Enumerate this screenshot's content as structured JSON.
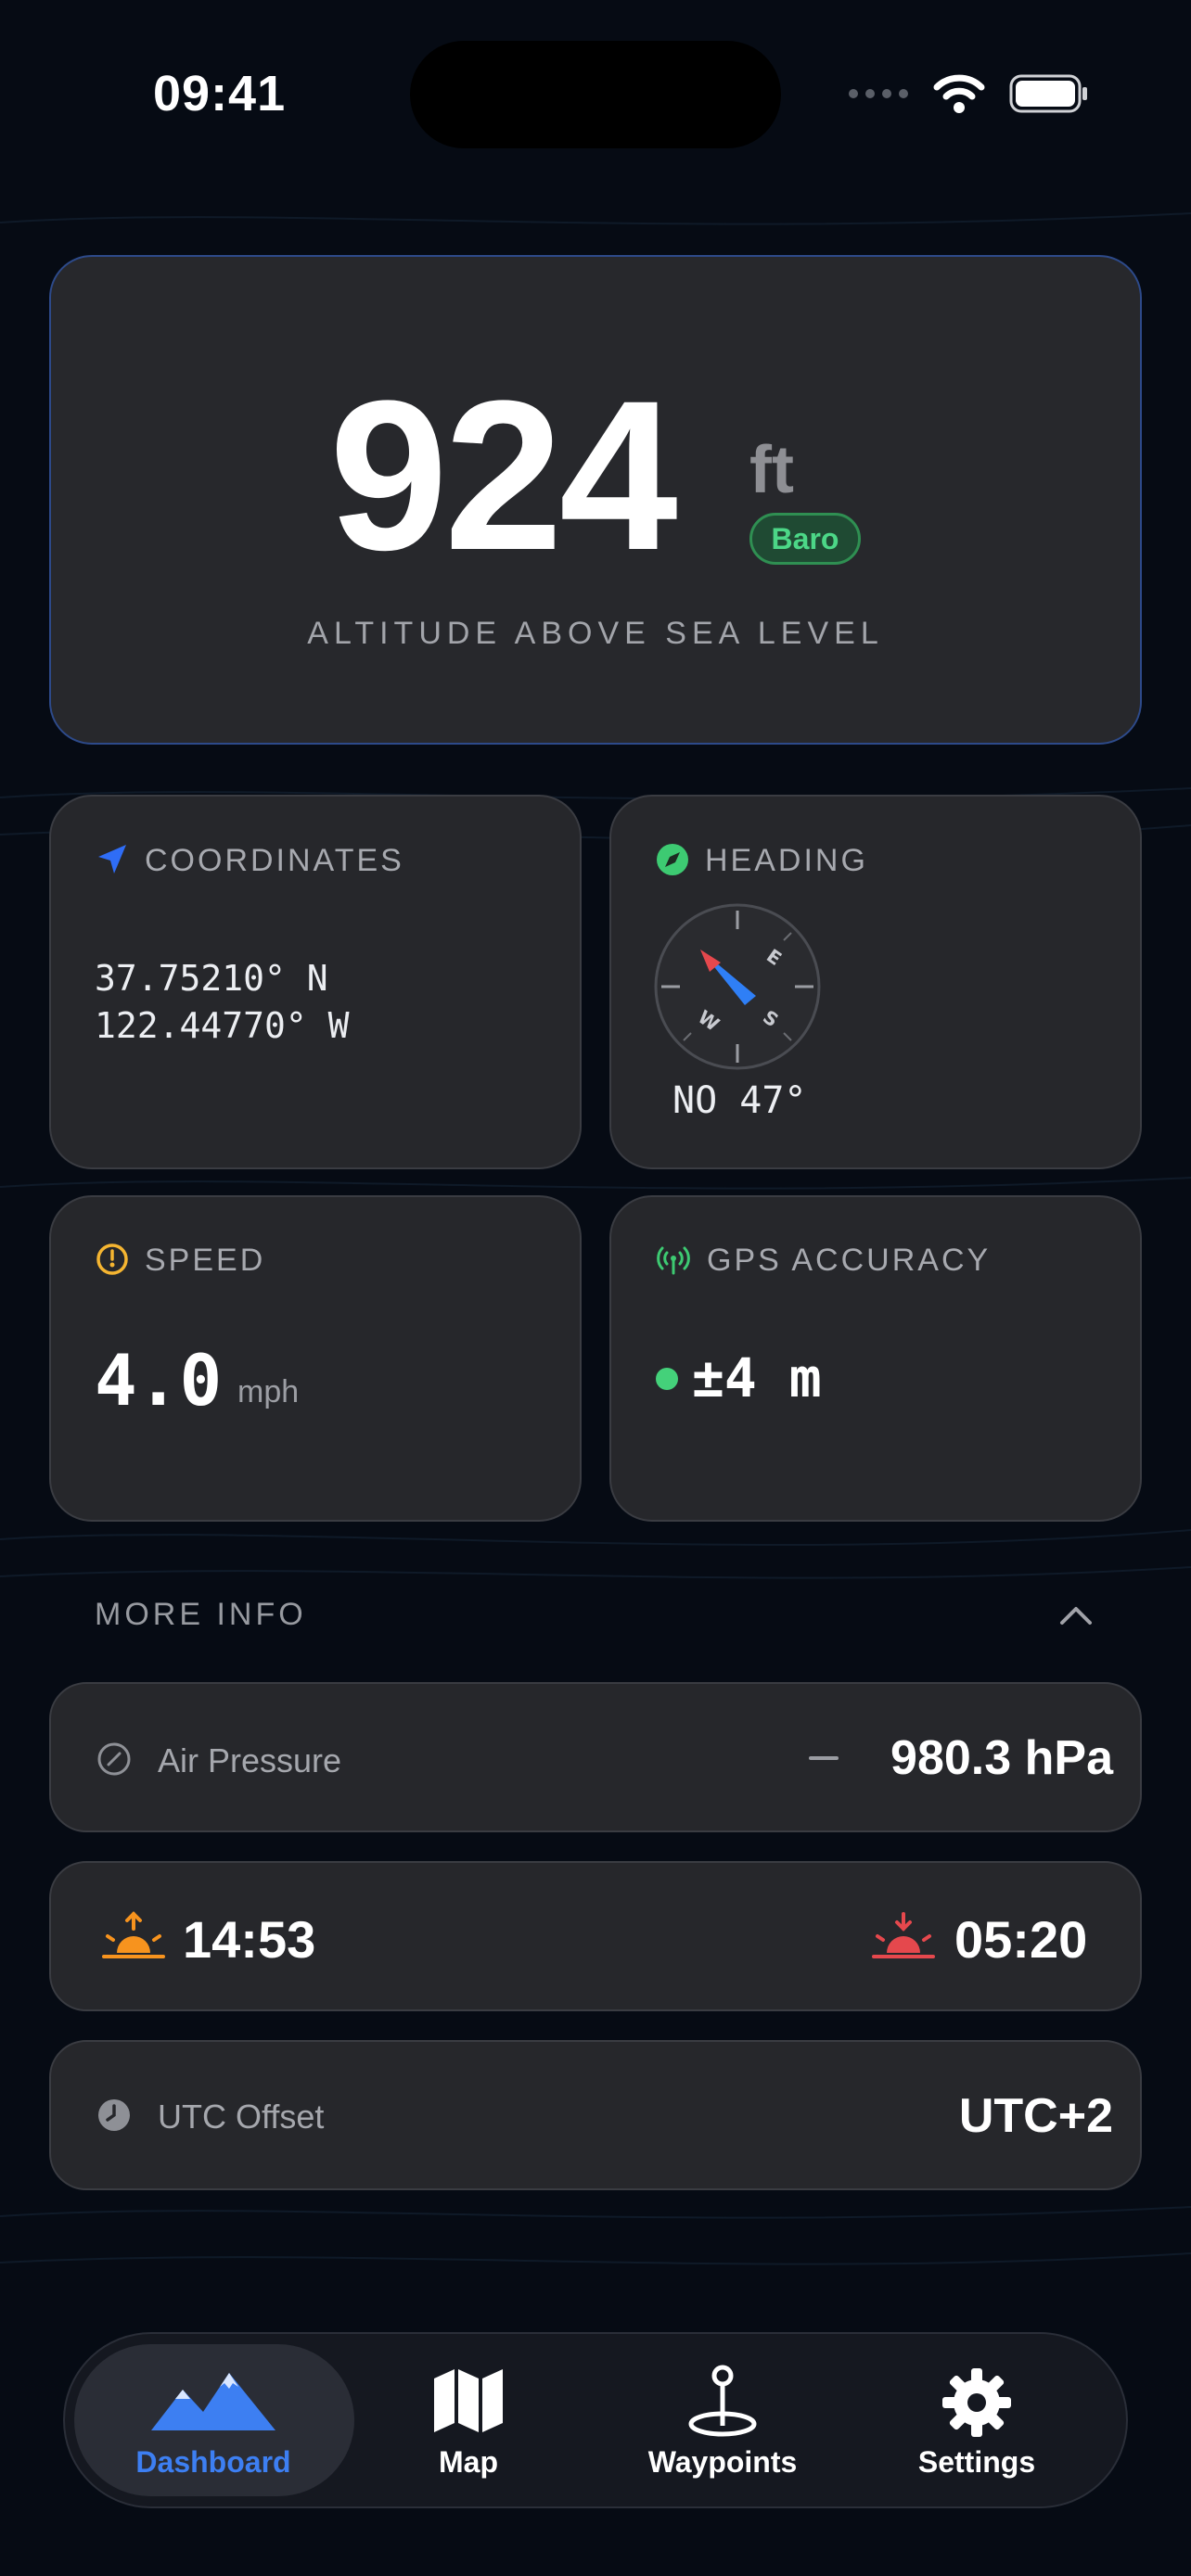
{
  "status_bar": {
    "time": "09:41"
  },
  "altitude": {
    "value": "924",
    "unit": "ft",
    "badge": "Baro",
    "label": "ALTITUDE ABOVE SEA LEVEL"
  },
  "coordinates": {
    "title": "COORDINATES",
    "lat": "37.75210° N",
    "lon": "122.44770° W"
  },
  "heading": {
    "title": "HEADING",
    "value": "NO 47°",
    "compass_labels": {
      "e": "E",
      "s": "S",
      "w": "W"
    }
  },
  "speed": {
    "title": "SPEED",
    "value": "4.0",
    "unit": "mph"
  },
  "gps_accuracy": {
    "title": "GPS ACCURACY",
    "value": "±4 m"
  },
  "more_info": {
    "label": "MORE INFO",
    "air_pressure": {
      "label": "Air Pressure",
      "value": "980.3 hPa"
    },
    "sunrise": "14:53",
    "sunset": "05:20",
    "utc_offset": {
      "label": "UTC Offset",
      "value": "UTC+2"
    }
  },
  "tabs": [
    {
      "label": "Dashboard",
      "active": true
    },
    {
      "label": "Map",
      "active": false
    },
    {
      "label": "Waypoints",
      "active": false
    },
    {
      "label": "Settings",
      "active": false
    }
  ],
  "colors": {
    "background": "#060b14",
    "card": "#26272b",
    "accent_blue": "#3b82f6",
    "accent_green": "#4cd787",
    "sunrise_orange": "#f7931e",
    "sunset_red": "#e5484d"
  }
}
